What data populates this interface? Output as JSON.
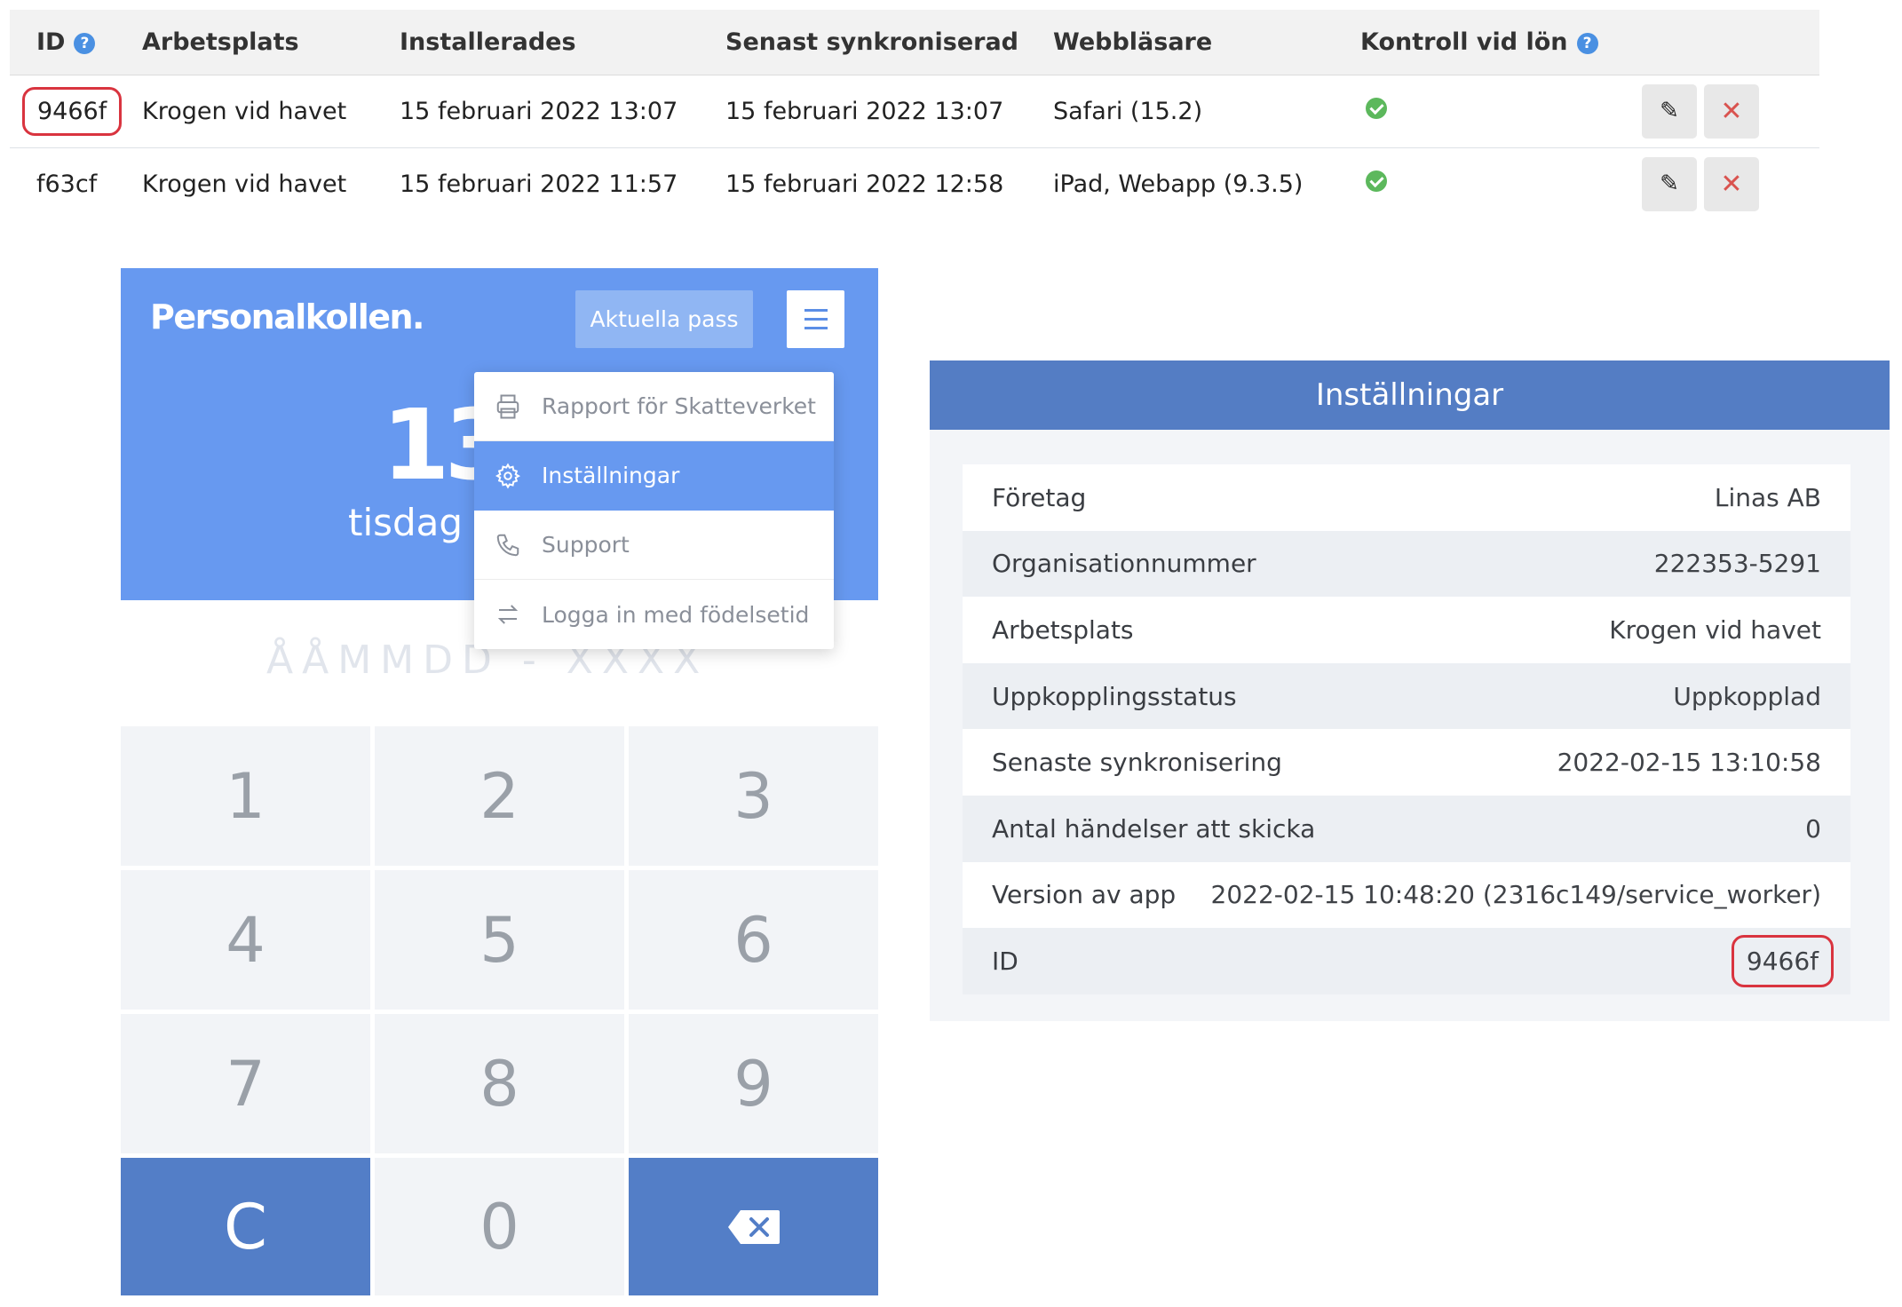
{
  "table": {
    "headers": {
      "id": "ID",
      "place": "Arbetsplats",
      "installed": "Installerades",
      "synced": "Senast synkroniserad",
      "browser": "Webbläsare",
      "control": "Kontroll vid lön"
    },
    "rows": [
      {
        "id": "9466f",
        "place": "Krogen vid havet",
        "installed": "15 februari 2022 13:07",
        "synced": "15 februari 2022 13:07",
        "browser": "Safari (15.2)",
        "control_ok": true
      },
      {
        "id": "f63cf",
        "place": "Krogen vid havet",
        "installed": "15 februari 2022 11:57",
        "synced": "15 februari 2022 12:58",
        "browser": "iPad, Webapp (9.3.5)",
        "control_ok": true
      }
    ],
    "status_color": "#5cb85c",
    "delete_color": "#d9534f"
  },
  "app": {
    "logo": "Personalkollen.",
    "current_shifts": "Aktuella pass",
    "time_partial": "13",
    "date_partial": "tisdag 1",
    "pin_mask": "ÅÅMMDD - XXXX",
    "accent_color": "#6799f0",
    "menu": [
      {
        "label": "Rapport för Skatteverket",
        "icon": "printer-icon",
        "active": false
      },
      {
        "label": "Inställningar",
        "icon": "gear-icon",
        "active": true
      },
      {
        "label": "Support",
        "icon": "phone-icon",
        "active": false
      },
      {
        "label": "Logga in med födelsetid",
        "icon": "swap-arrows-icon",
        "active": false
      }
    ],
    "keypad": [
      "1",
      "2",
      "3",
      "4",
      "5",
      "6",
      "7",
      "8",
      "9",
      "C",
      "0",
      "backspace"
    ]
  },
  "settings": {
    "title": "Inställningar",
    "header_color": "#547dc4",
    "rows": [
      {
        "label": "Företag",
        "value": "Linas AB"
      },
      {
        "label": "Organisationnummer",
        "value": "222353-5291"
      },
      {
        "label": "Arbetsplats",
        "value": "Krogen vid havet"
      },
      {
        "label": "Uppkopplingsstatus",
        "value": "Uppkopplad"
      },
      {
        "label": "Senaste synkronisering",
        "value": "2022-02-15 13:10:58"
      },
      {
        "label": "Antal händelser att skicka",
        "value": "0"
      },
      {
        "label": "Version av app",
        "value": "2022-02-15 10:48:20 (2316c149/service_worker)"
      },
      {
        "label": "ID",
        "value": "9466f"
      }
    ],
    "highlight_color": "#d9343f"
  }
}
